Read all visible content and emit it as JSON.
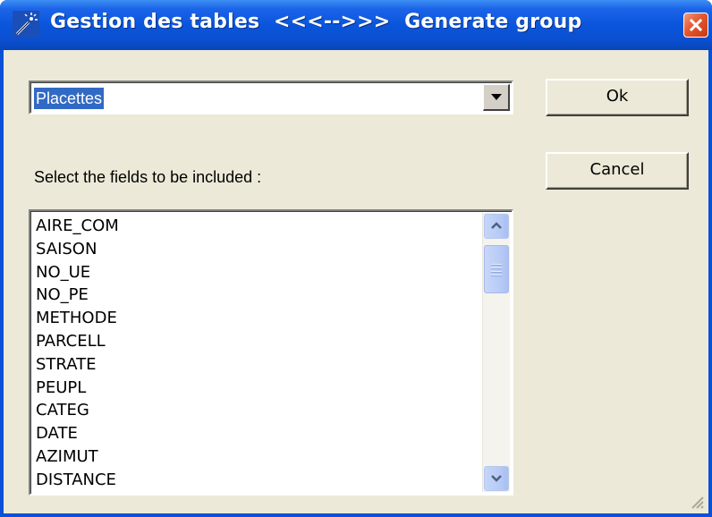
{
  "window": {
    "title": "Gestion des tables  <<<-->>>  Generate group",
    "icon": "magic-wand-icon",
    "close_icon": "close-icon"
  },
  "table_select": {
    "selected_value": "Placettes",
    "dropdown_icon": "chevron-down-icon"
  },
  "buttons": {
    "ok_label": "Ok",
    "cancel_label": "Cancel"
  },
  "fields_prompt": "Select the fields to be included :",
  "fields": [
    "AIRE_COM",
    "SAISON",
    "NO_UE",
    "NO_PE",
    "METHODE",
    "PARCELL",
    "STRATE",
    "PEUPL",
    "CATEG",
    "DATE",
    "AZIMUT",
    "DISTANCE"
  ],
  "colors": {
    "titlebar": "#0a55dc",
    "selection": "#316ac5",
    "dialog_bg": "#ece9d8",
    "close_button": "#e4572f"
  }
}
